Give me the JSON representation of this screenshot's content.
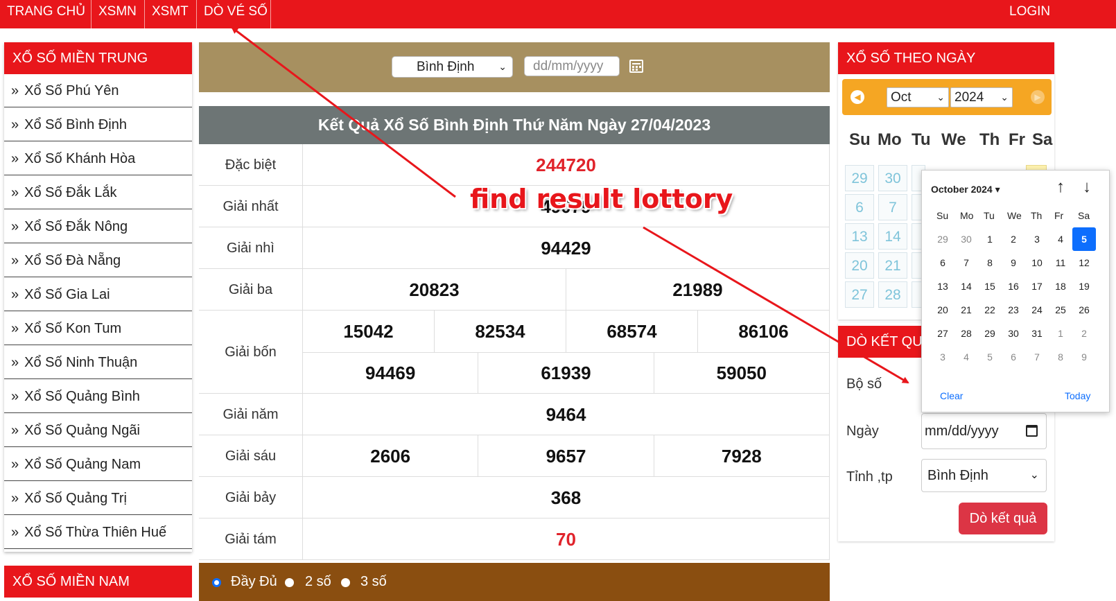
{
  "nav": {
    "items": [
      "TRANG CHỦ",
      "XSMN",
      "XSMT",
      "DÒ VÉ SỐ"
    ],
    "login": "LOGIN"
  },
  "sidebar": {
    "heading": "XỔ SỐ MIỀN TRUNG",
    "items": [
      "Xổ Số Phú Yên",
      "Xổ Số Bình Định",
      "Xổ Số Khánh Hòa",
      "Xổ Số Đắk Lắk",
      "Xổ Số Đắk Nông",
      "Xổ Số Đà Nẵng",
      "Xổ Số Gia Lai",
      "Xổ Số Kon Tum",
      "Xổ Số Ninh Thuận",
      "Xổ Số Quảng Bình",
      "Xổ Số Quảng Ngãi",
      "Xổ Số Quảng Nam",
      "Xổ Số Quảng Trị",
      "Xổ Số Thừa Thiên Huế"
    ],
    "heading2": "XỔ SỐ MIỀN NAM"
  },
  "filter": {
    "province": "Bình Định",
    "date_placeholder": "dd/mm/yyyy"
  },
  "results": {
    "title": "Kết Quả Xổ Số Bình Định Thứ Năm Ngày 27/04/2023",
    "rows": [
      {
        "label": "Đặc biệt",
        "values": [
          "244720"
        ]
      },
      {
        "label": "Giải nhất",
        "values": [
          "49079"
        ]
      },
      {
        "label": "Giải nhì",
        "values": [
          "94429"
        ]
      },
      {
        "label": "Giải ba",
        "values": [
          "20823",
          "21989"
        ]
      },
      {
        "label": "Giải bốn",
        "values": [
          "15042",
          "82534",
          "68574",
          "86106",
          "94469",
          "61939",
          "59050"
        ]
      },
      {
        "label": "Giải năm",
        "values": [
          "9464"
        ]
      },
      {
        "label": "Giải sáu",
        "values": [
          "2606",
          "9657",
          "7928"
        ]
      },
      {
        "label": "Giải bảy",
        "values": [
          "368"
        ]
      },
      {
        "label": "Giải tám",
        "values": [
          "70"
        ]
      }
    ],
    "options": [
      "Đầy Đủ",
      "2 số",
      "3 số"
    ]
  },
  "calendar": {
    "heading": "XỔ SỐ THEO NGÀY",
    "month": "Oct",
    "year": "2024",
    "weekdays": [
      "Su",
      "Mo",
      "Tu",
      "We",
      "Th",
      "Fr",
      "Sa"
    ],
    "visible_days": [
      [
        "29",
        "30"
      ],
      [
        "6",
        "7"
      ],
      [
        "13",
        "14"
      ],
      [
        "20",
        "21"
      ],
      [
        "27",
        "28"
      ]
    ]
  },
  "check": {
    "heading": "DÒ KẾT QUẢ",
    "number_label": "Bộ số",
    "date_label": "Ngày",
    "date_placeholder": "mm/dd/yyyy",
    "province_label": "Tỉnh ,tp",
    "province_value": "Bình Định",
    "button": "Dò kết quả"
  },
  "datepicker": {
    "title": "October 2024 ▾",
    "weekdays": [
      "Su",
      "Mo",
      "Tu",
      "We",
      "Th",
      "Fr",
      "Sa"
    ],
    "weeks": [
      [
        "29",
        "30",
        "1",
        "2",
        "3",
        "4",
        "5"
      ],
      [
        "6",
        "7",
        "8",
        "9",
        "10",
        "11",
        "12"
      ],
      [
        "13",
        "14",
        "15",
        "16",
        "17",
        "18",
        "19"
      ],
      [
        "20",
        "21",
        "22",
        "23",
        "24",
        "25",
        "26"
      ],
      [
        "27",
        "28",
        "29",
        "30",
        "31",
        "1",
        "2"
      ],
      [
        "3",
        "4",
        "5",
        "6",
        "7",
        "8",
        "9"
      ]
    ],
    "active_day": "5",
    "clear": "Clear",
    "today": "Today"
  },
  "annotation": "find result lottory",
  "colors": {
    "brand_red": "#e8161b",
    "filter_bg": "#a79060",
    "title_bg": "#6d7575",
    "options_bg": "#8a4e10",
    "calendar_bar": "#f5a623",
    "button": "#dc3545",
    "active": "#0d6efd"
  }
}
